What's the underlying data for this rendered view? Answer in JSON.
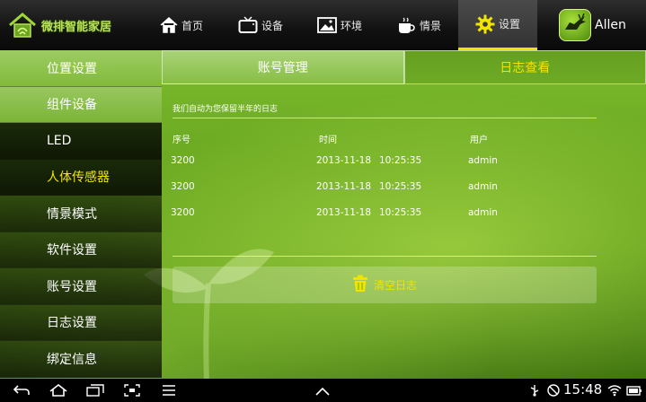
{
  "app": {
    "logo_text": "微排智能家居"
  },
  "nav": [
    {
      "label": "首页",
      "icon": "home-icon"
    },
    {
      "label": "设备",
      "icon": "tv-icon"
    },
    {
      "label": "环境",
      "icon": "picture-icon"
    },
    {
      "label": "情景",
      "icon": "coffee-cup-icon"
    },
    {
      "label": "设置",
      "icon": "gear-icon",
      "active": true
    }
  ],
  "user": {
    "name": "Allen"
  },
  "sidebar": {
    "items": [
      {
        "label": "位置设置"
      },
      {
        "label": "组件设备"
      },
      {
        "label": "LED"
      },
      {
        "label": "人体传感器",
        "selected": true
      },
      {
        "label": "情景模式"
      },
      {
        "label": "软件设置"
      },
      {
        "label": "账号设置"
      },
      {
        "label": "日志设置"
      },
      {
        "label": "绑定信息"
      }
    ]
  },
  "tabs": [
    {
      "label": "账号管理"
    },
    {
      "label": "日志查看",
      "active": true
    }
  ],
  "log": {
    "note": "我们自动为您保留半年的日志",
    "headers": {
      "seq": "序号",
      "time": "时间",
      "user": "用户"
    },
    "rows": [
      {
        "seq": "3200",
        "date": "2013-11-18",
        "time": "10:25:35",
        "user": "admin"
      },
      {
        "seq": "3200",
        "date": "2013-11-18",
        "time": "10:25:35",
        "user": "admin"
      },
      {
        "seq": "3200",
        "date": "2013-11-18",
        "time": "10:25:35",
        "user": "admin"
      }
    ],
    "clear_label": "清空日志"
  },
  "statusbar": {
    "time": "15:48"
  },
  "colors": {
    "accent": "#f0e400",
    "green": "#6aa824"
  }
}
